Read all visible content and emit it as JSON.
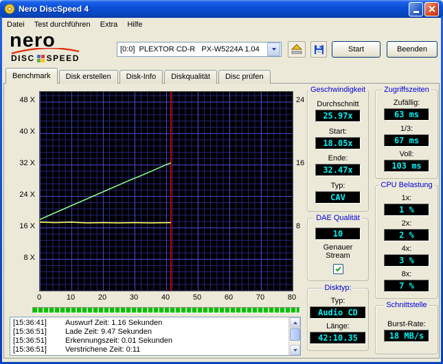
{
  "window": {
    "title": "Nero DiscSpeed 4"
  },
  "menu": {
    "items": [
      "Datei",
      "Test durchführen",
      "Extra",
      "Hilfe"
    ]
  },
  "logo": {
    "brand": "nero",
    "product_left": "DISC",
    "product_right": "SPEED"
  },
  "toolbar": {
    "drive_select": "[0:0]  PLEXTOR CD-R   PX-W5224A 1.04",
    "start_button": "Start",
    "quit_button": "Beenden"
  },
  "tabs": [
    {
      "label": "Benchmark",
      "active": true
    },
    {
      "label": "Disk erstellen",
      "active": false
    },
    {
      "label": "Disk-Info",
      "active": false
    },
    {
      "label": "Diskqualität",
      "active": false
    },
    {
      "label": "Disc prüfen",
      "active": false
    }
  ],
  "chart_data": {
    "type": "line",
    "title": "",
    "xlabel": "",
    "ylabel": "",
    "x_axis": {
      "min": 0,
      "max": 80,
      "ticks": [
        0,
        10,
        20,
        30,
        40,
        50,
        60,
        70,
        80
      ]
    },
    "y_axis_left": {
      "max": 50.5,
      "ticks": [
        {
          "label": "48 X",
          "value": 48
        },
        {
          "label": "40 X",
          "value": 40
        },
        {
          "label": "32 X",
          "value": 32
        },
        {
          "label": "24 X",
          "value": 24
        },
        {
          "label": "16 X",
          "value": 16
        },
        {
          "label": "8 X",
          "value": 8
        }
      ]
    },
    "y_axis_right": {
      "ticks": [
        {
          "label": "24",
          "value": 48
        },
        {
          "label": "16",
          "value": 32
        },
        {
          "label": "8",
          "value": 16
        }
      ]
    },
    "grid": true,
    "series": [
      {
        "name": "read-speed-cav",
        "color": "#8CFC8C",
        "points": [
          [
            0,
            18.05
          ],
          [
            4,
            19.5
          ],
          [
            8,
            20.9
          ],
          [
            12,
            22.3
          ],
          [
            16,
            23.7
          ],
          [
            20,
            25.1
          ],
          [
            24,
            26.5
          ],
          [
            28,
            27.9
          ],
          [
            32,
            29.2
          ],
          [
            36,
            30.6
          ],
          [
            40,
            32.0
          ],
          [
            41.5,
            32.47
          ]
        ]
      },
      {
        "name": "secondary-flat",
        "color": "#FFFF55",
        "points": [
          [
            0,
            17.4
          ],
          [
            5,
            17.3
          ],
          [
            10,
            17.4
          ],
          [
            15,
            17.2
          ],
          [
            20,
            17.3
          ],
          [
            25,
            17.2
          ],
          [
            30,
            17.3
          ],
          [
            35,
            17.2
          ],
          [
            41.5,
            17.3
          ]
        ]
      }
    ],
    "markers": [
      {
        "type": "vline",
        "x": 41.5,
        "color": "#CC0000"
      }
    ]
  },
  "results": {
    "speed": {
      "title": "Geschwindigkeit",
      "rows": [
        {
          "label": "Durchschnitt",
          "value": "25.97x"
        },
        {
          "label": "Start:",
          "value": "18.05x"
        },
        {
          "label": "Ende:",
          "value": "32.47x"
        },
        {
          "label": "Typ:",
          "value": "CAV"
        }
      ]
    },
    "access": {
      "title": "Zugriffszeiten",
      "rows": [
        {
          "label": "Zufällig:",
          "value": "63 ms"
        },
        {
          "label": "1/3:",
          "value": "67 ms"
        },
        {
          "label": "Voll:",
          "value": "103 ms"
        }
      ]
    },
    "cpu": {
      "title": "CPU Belastung",
      "rows": [
        {
          "label": "1x:",
          "value": "1 %"
        },
        {
          "label": "2x:",
          "value": "2 %"
        },
        {
          "label": "4x:",
          "value": "3 %"
        },
        {
          "label": "8x:",
          "value": "7 %"
        }
      ]
    },
    "dae": {
      "title": "DAE Qualität",
      "value": "10",
      "stream_label": "Genauer Stream",
      "checked": true
    },
    "disctype": {
      "title": "Disktyp:",
      "rows": [
        {
          "label": "Typ:",
          "value": "Audio CD"
        },
        {
          "label": "Länge:",
          "value": "42:10.35"
        }
      ]
    },
    "interface": {
      "title": "Schnittstelle",
      "rows": [
        {
          "label": "Burst-Rate:",
          "value": "18 MB/s"
        }
      ]
    }
  },
  "log": {
    "lines": [
      {
        "time": "[15:36:41]",
        "text": "Auswurf Zeit: 1.16 Sekunden"
      },
      {
        "time": "[15:36:51]",
        "text": "Lade Zeit: 9.47 Sekunden"
      },
      {
        "time": "[15:36:51]",
        "text": "Erkennungszeit: 0.01 Sekunden"
      },
      {
        "time": "[15:36:51]",
        "text": "Verstrichene Zeit: 0:11"
      }
    ]
  },
  "colors": {
    "lcd_text": "#00F2F2",
    "group_title": "#0000D8",
    "progress_green": "#00C400",
    "plot_background": "#000000",
    "grid_blue": "#3A3AB4"
  }
}
